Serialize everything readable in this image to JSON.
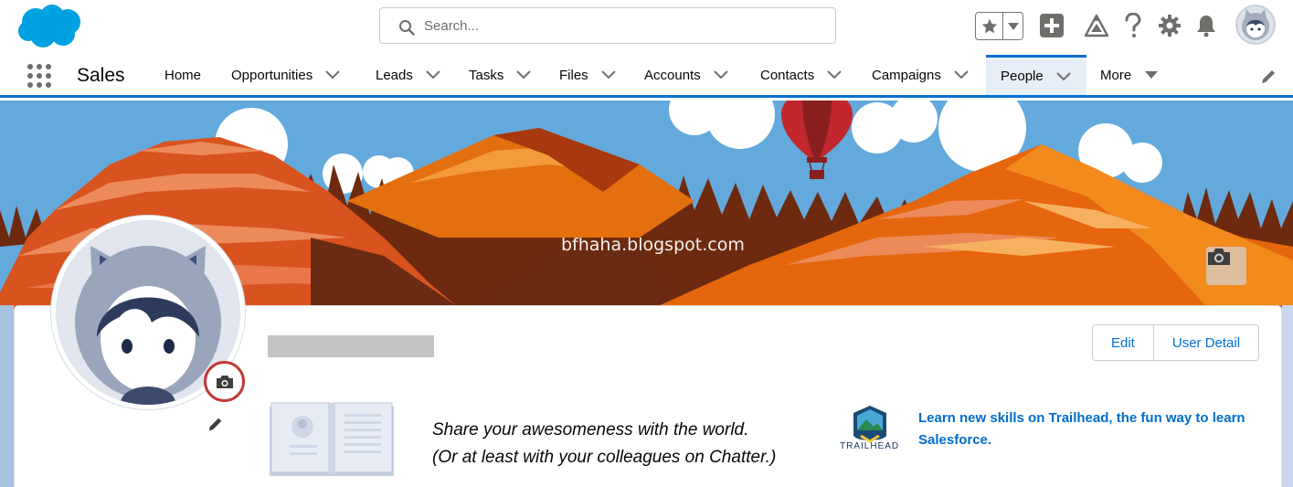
{
  "header": {
    "search_placeholder": "Search...",
    "icons": [
      "salesforce-cloud-logo",
      "search-icon",
      "star-icon",
      "caret-down-icon",
      "plus-icon",
      "trailhead-icon",
      "help-icon",
      "gear-icon",
      "bell-icon",
      "avatar"
    ]
  },
  "nav": {
    "app_name": "Sales",
    "items": [
      {
        "label": "Home",
        "has_menu": false
      },
      {
        "label": "Opportunities",
        "has_menu": true
      },
      {
        "label": "Leads",
        "has_menu": true
      },
      {
        "label": "Tasks",
        "has_menu": true
      },
      {
        "label": "Files",
        "has_menu": true
      },
      {
        "label": "Accounts",
        "has_menu": true
      },
      {
        "label": "Contacts",
        "has_menu": true
      },
      {
        "label": "Campaigns",
        "has_menu": true
      },
      {
        "label": "People",
        "has_menu": true,
        "active": true
      },
      {
        "label": "More",
        "has_menu": true
      }
    ]
  },
  "banner": {
    "watermark": "bfhaha.blogspot.com"
  },
  "profile": {
    "buttons": {
      "edit": "Edit",
      "user_detail": "User Detail"
    },
    "share_line1": "Share your awesomeness with the world.",
    "share_line2": "(Or at least with your colleagues on Chatter.)",
    "trailhead_word": "TRAILHEAD",
    "trailhead_text": "Learn new skills on Trailhead, the fun way to learn Salesforce."
  },
  "colors": {
    "brand_blue": "#0070d2",
    "highlight_red": "#c23934",
    "link_blue": "#006dcc"
  }
}
